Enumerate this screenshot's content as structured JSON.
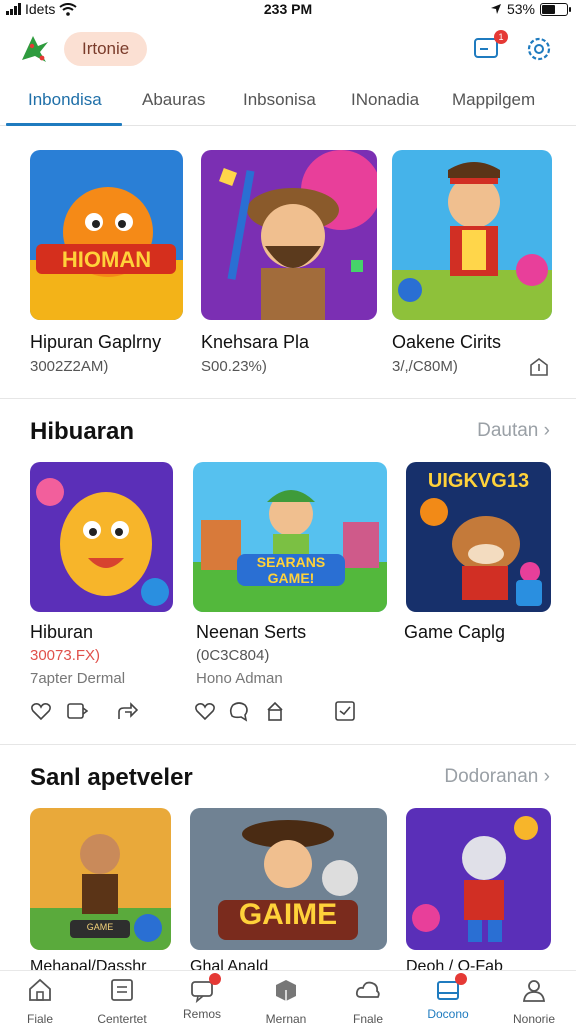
{
  "status_bar": {
    "carrier": "Idets",
    "time": "233 PM",
    "battery": "53%",
    "battery_level": 0.53
  },
  "header": {
    "home_label": "Irtonie",
    "notification_count": "1"
  },
  "tabs": [
    {
      "label": "Inbondisa",
      "active": true
    },
    {
      "label": "Abauras"
    },
    {
      "label": "Inbsonisa"
    },
    {
      "label": "INonadia"
    },
    {
      "label": "Mappilgem"
    }
  ],
  "top_row": [
    {
      "title": "Hipuran Gaplrny",
      "meta": "3002Z2AM)",
      "banner": "HIOMAN"
    },
    {
      "title": "Knehsara Pla",
      "meta": "S00.23%)"
    },
    {
      "title": "Oakene Cirits",
      "meta": "3/,/C80M)"
    }
  ],
  "section1": {
    "title": "Hibuaran",
    "link": "Dautan",
    "cards": [
      {
        "title": "Hiburan",
        "meta": "30073.FX)",
        "sub": "7apter Dermal"
      },
      {
        "title": "Neenan Serts",
        "meta": "(0C3C804)",
        "sub": "Hono Adman",
        "banner": "SEARANS GAME!"
      },
      {
        "title": "Game Caplg",
        "banner": "UIGKVG13"
      }
    ]
  },
  "section2": {
    "title": "Sanl apetveler",
    "link": "Dodoranan",
    "cards": [
      {
        "title": "Mehapal/Dasshr",
        "banner": "GAME"
      },
      {
        "title": "Ghal Anald",
        "banner": "GAIME"
      },
      {
        "title": "Deoh / O-Fab"
      }
    ]
  },
  "bottom_nav": [
    {
      "label": "Fiale"
    },
    {
      "label": "Centertet"
    },
    {
      "label": "Remos"
    },
    {
      "label": "Mernan"
    },
    {
      "label": "Fnale"
    },
    {
      "label": "Docono",
      "active": true
    },
    {
      "label": "Nonorie"
    }
  ],
  "colors": {
    "accent": "#1f7bbf",
    "pill_bg": "#fbe0d3",
    "badge": "#e53935"
  }
}
